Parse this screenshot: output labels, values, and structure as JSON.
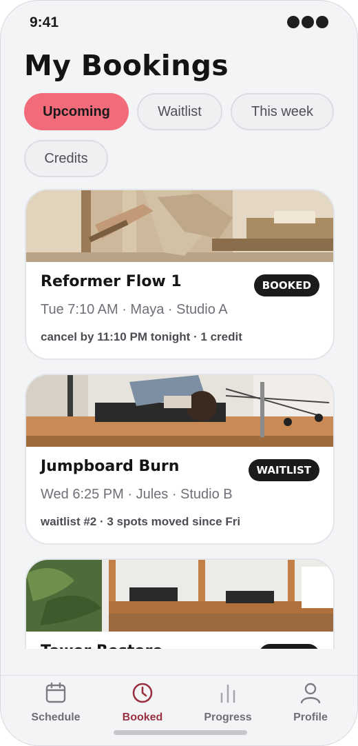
{
  "status_bar": {
    "time": "9:41"
  },
  "header": {
    "title": "My Bookings"
  },
  "filters": [
    {
      "label": "Upcoming",
      "active": true
    },
    {
      "label": "Waitlist",
      "active": false
    },
    {
      "label": "This week",
      "active": false
    },
    {
      "label": "Credits",
      "active": false
    }
  ],
  "bookings": [
    {
      "title": "Reformer Flow 1",
      "badge": "BOOKED",
      "meta": "Tue 7:10 AM · Maya · Studio A",
      "note": "cancel by 11:10 PM tonight · 1 credit"
    },
    {
      "title": "Jumpboard Burn",
      "badge": "WAITLIST",
      "meta": "Wed 6:25 PM · Jules · Studio B",
      "note": "waitlist #2 · 3 spots moved since Fri"
    },
    {
      "title": "Tower Restore",
      "badge": "",
      "meta": "",
      "note": ""
    }
  ],
  "tabbar": [
    {
      "label": "Schedule",
      "icon": "calendar-icon",
      "active": false
    },
    {
      "label": "Booked",
      "icon": "clock-icon",
      "active": true
    },
    {
      "label": "Progress",
      "icon": "bar-chart-icon",
      "active": false
    },
    {
      "label": "Profile",
      "icon": "person-icon",
      "active": false
    }
  ],
  "colors": {
    "accent": "#f26b7a",
    "active_tab": "#9b3140",
    "badge_bg": "#1b1b1b",
    "background": "#f3f4f6"
  }
}
